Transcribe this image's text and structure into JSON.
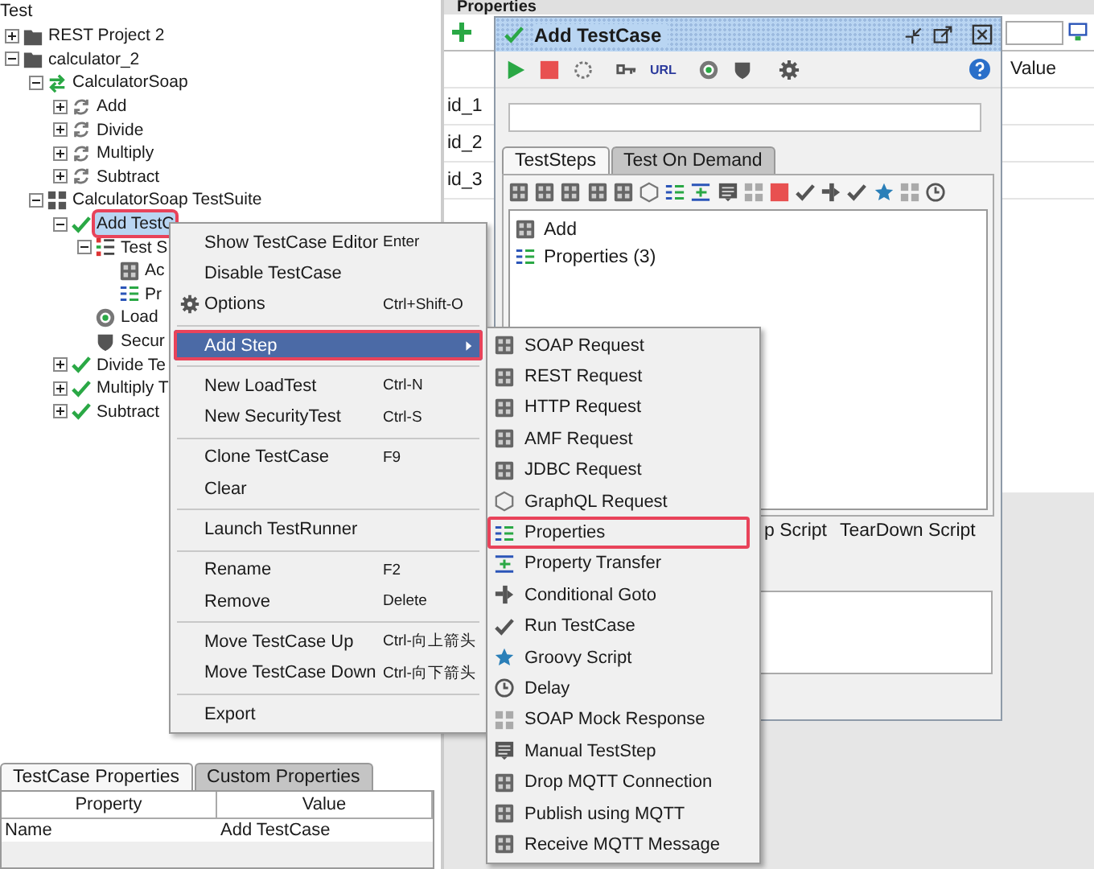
{
  "tree": {
    "header": "Test",
    "nodes": [
      {
        "label": "REST Project 2",
        "kind": "project",
        "expanded": false,
        "selected": false,
        "annotated": false
      },
      {
        "label": "calculator_2",
        "kind": "project",
        "expanded": true,
        "selected": false,
        "annotated": false,
        "children": [
          {
            "label": "CalculatorSoap",
            "kind": "interface",
            "expanded": true,
            "selected": false,
            "annotated": false,
            "children": [
              {
                "label": "Add",
                "kind": "operation",
                "expanded": false,
                "selected": false,
                "annotated": false
              },
              {
                "label": "Divide",
                "kind": "operation",
                "expanded": false,
                "selected": false,
                "annotated": false
              },
              {
                "label": "Multiply",
                "kind": "operation",
                "expanded": false,
                "selected": false,
                "annotated": false
              },
              {
                "label": "Subtract",
                "kind": "operation",
                "expanded": false,
                "selected": false,
                "annotated": false
              }
            ]
          },
          {
            "label": "CalculatorSoap TestSuite",
            "kind": "testsuite",
            "expanded": true,
            "selected": false,
            "annotated": false,
            "children": [
              {
                "label": "Add TestC",
                "kind": "testcase",
                "expanded": true,
                "selected": true,
                "annotated": true,
                "children": [
                  {
                    "label": "Test S",
                    "kind": "steps",
                    "expanded": true,
                    "selected": false,
                    "annotated": false,
                    "children": [
                      {
                        "label": "Ac",
                        "kind": "soap-step",
                        "selected": false,
                        "annotated": false
                      },
                      {
                        "label": "Pr",
                        "kind": "properties-step",
                        "selected": false,
                        "annotated": false
                      }
                    ]
                  },
                  {
                    "label": "Load",
                    "kind": "loadtest",
                    "selected": false,
                    "annotated": false
                  },
                  {
                    "label": "Secur",
                    "kind": "securitytest",
                    "selected": false,
                    "annotated": false
                  }
                ]
              },
              {
                "label": "Divide Te",
                "kind": "testcase",
                "expanded": false,
                "selected": false,
                "annotated": false
              },
              {
                "label": "Multiply T",
                "kind": "testcase",
                "expanded": false,
                "selected": false,
                "annotated": false
              },
              {
                "label": "Subtract",
                "kind": "testcase",
                "expanded": false,
                "selected": false,
                "annotated": false
              }
            ]
          }
        ]
      }
    ]
  },
  "properties_panel": {
    "title": "Properties",
    "columns": [
      "",
      "Value"
    ],
    "rows": [
      "id_1",
      "id_2",
      "id_3"
    ]
  },
  "testcase_window": {
    "title": "Add TestCase",
    "toolbar_label": "URL",
    "tabs": [
      {
        "label": "TestSteps",
        "selected": true
      },
      {
        "label": "Test On Demand",
        "selected": false
      }
    ],
    "steps": [
      {
        "label": "Add",
        "kind": "soap"
      },
      {
        "label": "Properties (3)",
        "kind": "properties"
      }
    ],
    "bottom_tabs": [
      "p Script",
      "TearDown Script"
    ]
  },
  "bottom_panel": {
    "tabs": [
      {
        "label": "TestCase Properties",
        "selected": true
      },
      {
        "label": "Custom Properties",
        "selected": false
      }
    ],
    "columns": [
      "Property",
      "Value"
    ],
    "rows": [
      {
        "property": "Name",
        "value": "Add TestCase"
      }
    ]
  },
  "context_menu": {
    "groups": [
      [
        {
          "label": "Show TestCase Editor",
          "shortcut": "Enter",
          "kind": "plain",
          "selected": false,
          "annotated": false
        },
        {
          "label": "Disable TestCase",
          "kind": "plain",
          "selected": false,
          "annotated": false
        },
        {
          "label": "Options",
          "shortcut": "Ctrl+Shift-O",
          "kind": "options",
          "selected": false,
          "annotated": false
        }
      ],
      [
        {
          "label": "Add Step",
          "kind": "submenu",
          "selected": true,
          "annotated": true
        }
      ],
      [
        {
          "label": "New LoadTest",
          "shortcut": "Ctrl-N",
          "kind": "plain",
          "selected": false,
          "annotated": false
        },
        {
          "label": "New SecurityTest",
          "shortcut": "Ctrl-S",
          "kind": "plain",
          "selected": false,
          "annotated": false
        }
      ],
      [
        {
          "label": "Clone TestCase",
          "shortcut": "F9",
          "kind": "plain",
          "selected": false,
          "annotated": false
        },
        {
          "label": "Clear",
          "kind": "plain",
          "selected": false,
          "annotated": false
        }
      ],
      [
        {
          "label": "Launch TestRunner",
          "kind": "plain",
          "selected": false,
          "annotated": false
        }
      ],
      [
        {
          "label": "Rename",
          "shortcut": "F2",
          "kind": "plain",
          "selected": false,
          "annotated": false
        },
        {
          "label": "Remove",
          "shortcut": "Delete",
          "kind": "plain",
          "selected": false,
          "annotated": false
        }
      ],
      [
        {
          "label": "Move TestCase Up",
          "shortcut": "Ctrl-向上箭头",
          "kind": "plain",
          "selected": false,
          "annotated": false
        },
        {
          "label": "Move TestCase Down",
          "shortcut": "Ctrl-向下箭头",
          "kind": "plain",
          "selected": false,
          "annotated": false
        }
      ],
      [
        {
          "label": "Export",
          "kind": "plain",
          "selected": false,
          "annotated": false
        }
      ]
    ]
  },
  "submenu": {
    "items": [
      {
        "label": "SOAP Request",
        "kind": "soap",
        "selected": false,
        "annotated": false
      },
      {
        "label": "REST Request",
        "kind": "rest",
        "selected": false,
        "annotated": false
      },
      {
        "label": "HTTP Request",
        "kind": "http",
        "selected": false,
        "annotated": false
      },
      {
        "label": "AMF Request",
        "kind": "amf",
        "selected": false,
        "annotated": false
      },
      {
        "label": "JDBC Request",
        "kind": "jdbc",
        "selected": false,
        "annotated": false
      },
      {
        "label": "GraphQL Request",
        "kind": "graphql",
        "selected": false,
        "annotated": false
      },
      {
        "label": "Properties",
        "kind": "properties",
        "selected": false,
        "annotated": true
      },
      {
        "label": "Property Transfer",
        "kind": "transfer",
        "selected": false,
        "annotated": false
      },
      {
        "label": "Conditional Goto",
        "kind": "goto",
        "selected": false,
        "annotated": false
      },
      {
        "label": "Run TestCase",
        "kind": "run",
        "selected": false,
        "annotated": false
      },
      {
        "label": "Groovy Script",
        "kind": "groovy",
        "selected": false,
        "annotated": false
      },
      {
        "label": "Delay",
        "kind": "delay",
        "selected": false,
        "annotated": false
      },
      {
        "label": "SOAP Mock Response",
        "kind": "mock",
        "selected": false,
        "annotated": false
      },
      {
        "label": "Manual TestStep",
        "kind": "manual",
        "selected": false,
        "annotated": false
      },
      {
        "label": "Drop MQTT Connection",
        "kind": "mqtt",
        "selected": false,
        "annotated": false
      },
      {
        "label": "Publish using MQTT",
        "kind": "mqtt",
        "selected": false,
        "annotated": false
      },
      {
        "label": "Receive MQTT Message",
        "kind": "mqtt",
        "selected": false,
        "annotated": false
      }
    ]
  }
}
